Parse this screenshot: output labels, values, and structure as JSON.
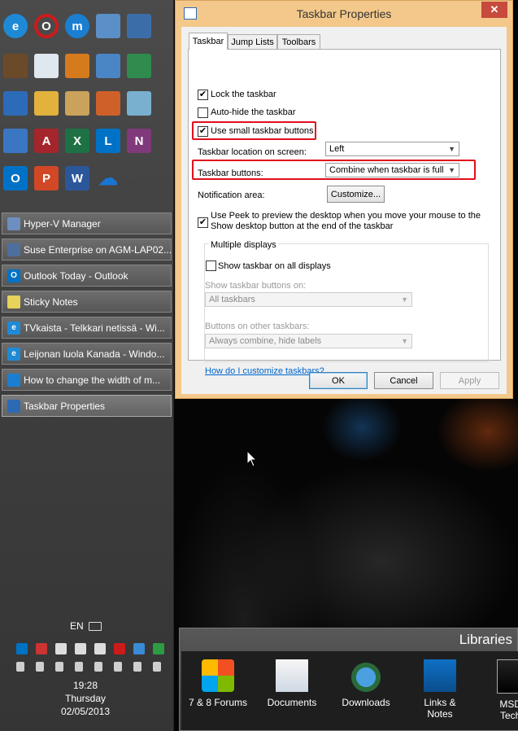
{
  "taskbar": {
    "pinned_icons": [
      [
        "internet-explorer-icon",
        "opera-icon",
        "maxthon-icon",
        "desktop-icon",
        "remote-desktop-icon"
      ],
      [
        "movie-maker-icon",
        "window-app-icon",
        "control-panel-icon",
        "network-computer-icon",
        "molecule-icon"
      ],
      [
        "computer-management-icon",
        "file-explorer-icon",
        "user-security-icon",
        "thermometer-icon",
        "server-icon"
      ],
      [
        "computer-settings-icon",
        "access-icon",
        "excel-icon",
        "lync-icon",
        "onenote-icon"
      ],
      [
        "outlook-icon",
        "powerpoint-icon",
        "word-icon",
        "onedrive-icon"
      ]
    ],
    "pinned_letters": [
      [
        "e",
        "O",
        "m",
        "",
        ""
      ],
      [
        "",
        "",
        "",
        "",
        ""
      ],
      [
        "",
        "",
        "",
        "",
        ""
      ],
      [
        "",
        "A",
        "X",
        "L",
        "N"
      ],
      [
        "O",
        "P",
        "W",
        ""
      ]
    ],
    "tasks": [
      {
        "label": "Hyper-V Manager",
        "icon": "hyper-v-icon"
      },
      {
        "label": "Suse Enterprise on AGM-LAP02...",
        "icon": "virtual-machine-icon"
      },
      {
        "label": "Outlook Today - Outlook",
        "icon": "outlook-icon"
      },
      {
        "label": "Sticky Notes",
        "icon": "sticky-notes-icon"
      },
      {
        "label": "TVkaista - Telkkari netissä - Wi...",
        "icon": "internet-explorer-icon"
      },
      {
        "label": "Leijonan luola Kanada - Windo...",
        "icon": "internet-explorer-icon"
      },
      {
        "label": "How to change the width of m...",
        "icon": "maxthon-icon"
      },
      {
        "label": "Taskbar Properties",
        "icon": "taskbar-properties-icon"
      }
    ],
    "tray": {
      "language": "EN",
      "time": "19:28",
      "day": "Thursday",
      "date": "02/05/2013"
    }
  },
  "dialog": {
    "title": "Taskbar Properties",
    "close": "✕",
    "tabs": [
      "Taskbar",
      "Jump Lists",
      "Toolbars"
    ],
    "selected_tab": "Taskbar",
    "lock_taskbar": {
      "label": "Lock the taskbar",
      "checked": true
    },
    "auto_hide": {
      "label": "Auto-hide the taskbar",
      "checked": false
    },
    "small_buttons": {
      "label": "Use small taskbar buttons",
      "checked": true
    },
    "location": {
      "label": "Taskbar location on screen:",
      "value": "Left"
    },
    "buttons": {
      "label": "Taskbar buttons:",
      "value": "Combine when taskbar is full"
    },
    "notification": {
      "label": "Notification area:",
      "button": "Customize..."
    },
    "peek": {
      "label_line1": "Use Peek to preview the desktop when you move your mouse to the",
      "label_line2": "Show desktop button at the end of the taskbar",
      "checked": true
    },
    "multiple_displays": {
      "group_label": "Multiple displays",
      "show_all": {
        "label": "Show taskbar on all displays",
        "checked": false
      },
      "show_buttons_on_label": "Show taskbar buttons on:",
      "show_buttons_on_value": "All taskbars",
      "other_taskbars_label": "Buttons on other taskbars:",
      "other_taskbars_value": "Always combine, hide labels"
    },
    "help_link": "How do I customize taskbars?",
    "ok": "OK",
    "cancel": "Cancel",
    "apply": "Apply"
  },
  "libraries": {
    "title": "Libraries",
    "items": [
      {
        "line1": "7 & 8 Forums",
        "line2": ""
      },
      {
        "line1": "Documents",
        "line2": ""
      },
      {
        "line1": "Downloads",
        "line2": ""
      },
      {
        "line1": "Links &",
        "line2": "Notes"
      },
      {
        "line1": "MSDN",
        "line2": "TechN"
      }
    ]
  },
  "colors": {
    "highlight": "#e0101c",
    "dialog_frame": "#f3c88a",
    "link": "#0066cc"
  }
}
